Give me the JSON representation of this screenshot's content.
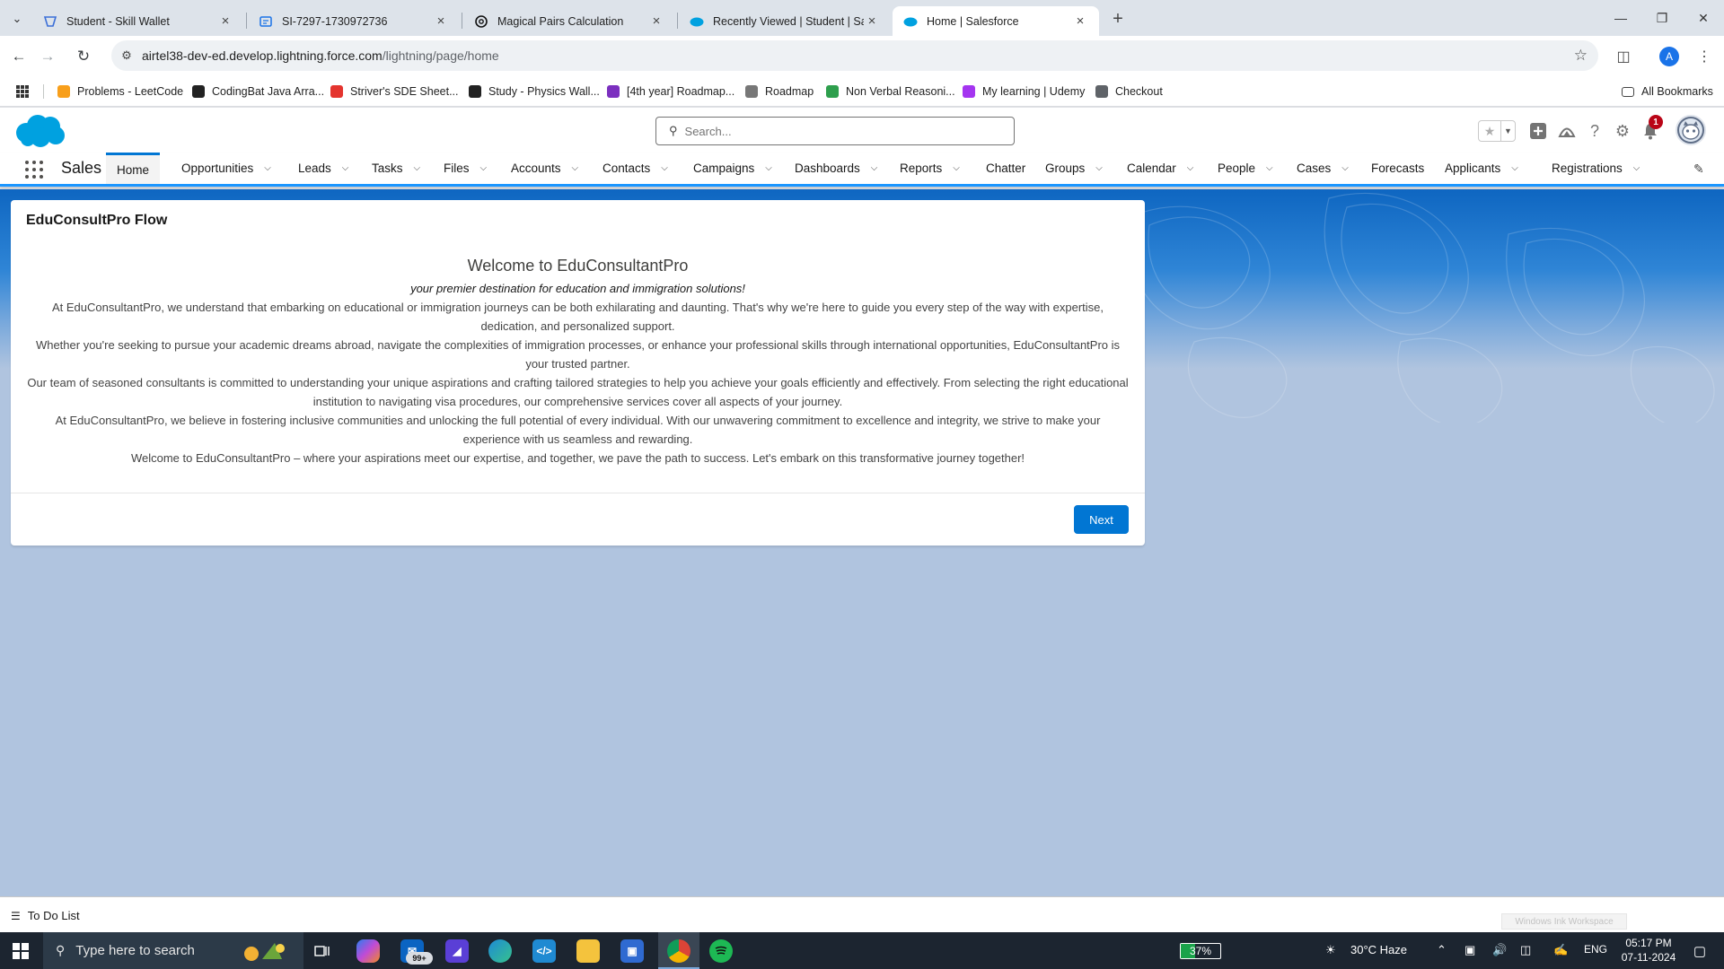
{
  "browser": {
    "tabs": [
      {
        "title": "Student - Skill Wallet",
        "icon": "skill-wallet-icon"
      },
      {
        "title": "SI-7297-1730972736",
        "icon": "document-icon"
      },
      {
        "title": "Magical Pairs Calculation",
        "icon": "chatgpt-icon"
      },
      {
        "title": "Recently Viewed | Student | Sal",
        "icon": "salesforce-cloud-icon"
      },
      {
        "title": "Home | Salesforce",
        "icon": "salesforce-cloud-icon"
      }
    ],
    "active_tab_index": 4,
    "url_host": "airtel38-dev-ed.develop.lightning.force.com",
    "url_path": "/lightning/page/home",
    "profile_initial": "A",
    "bookmarks": [
      {
        "label": "Problems - LeetCode",
        "icon": "leetcode-icon",
        "color": "#f89f1b"
      },
      {
        "label": "CodingBat Java Arra...",
        "icon": "codingbat-icon",
        "color": "#222222"
      },
      {
        "label": "Striver's SDE Sheet...",
        "icon": "tuf-icon",
        "color": "#e4342e"
      },
      {
        "label": "Study - Physics Wall...",
        "icon": "physics-wallah-icon",
        "color": "#222222"
      },
      {
        "label": "[4th year] Roadmap...",
        "icon": "roadmap-icon",
        "color": "#7b2fbf"
      },
      {
        "label": "Roadmap",
        "icon": "rocket-icon",
        "color": "#777777"
      },
      {
        "label": "Non Verbal Reasoni...",
        "icon": "leaf-icon",
        "color": "#2e9f4d"
      },
      {
        "label": "My learning | Udemy",
        "icon": "udemy-icon",
        "color": "#a435f0"
      },
      {
        "label": "Checkout",
        "icon": "checkout-icon",
        "color": "#5f6368"
      }
    ],
    "all_bookmarks_label": "All Bookmarks"
  },
  "sf": {
    "search_placeholder": "Search...",
    "notification_count": "1",
    "app_name": "Sales",
    "nav": [
      {
        "label": "Home",
        "dropdown": false,
        "active": true
      },
      {
        "label": "Opportunities",
        "dropdown": true
      },
      {
        "label": "Leads",
        "dropdown": true
      },
      {
        "label": "Tasks",
        "dropdown": true
      },
      {
        "label": "Files",
        "dropdown": true
      },
      {
        "label": "Accounts",
        "dropdown": true
      },
      {
        "label": "Contacts",
        "dropdown": true
      },
      {
        "label": "Campaigns",
        "dropdown": true
      },
      {
        "label": "Dashboards",
        "dropdown": true
      },
      {
        "label": "Reports",
        "dropdown": true
      },
      {
        "label": "Chatter",
        "dropdown": false
      },
      {
        "label": "Groups",
        "dropdown": true
      },
      {
        "label": "Calendar",
        "dropdown": true
      },
      {
        "label": "People",
        "dropdown": true
      },
      {
        "label": "Cases",
        "dropdown": true
      },
      {
        "label": "Forecasts",
        "dropdown": false
      },
      {
        "label": "Applicants",
        "dropdown": true
      },
      {
        "label": "Registrations",
        "dropdown": true
      }
    ]
  },
  "flow": {
    "title": "EduConsultPro Flow",
    "welcome": "Welcome to EduConsultantPro",
    "tagline": "your premier destination for education and immigration solutions!",
    "paragraphs": [
      "At EduConsultantPro, we understand that embarking on educational or immigration journeys can be both exhilarating and daunting. That's why we're here to guide you every step of the way with expertise, dedication, and personalized support.",
      "Whether you're seeking to pursue your academic dreams abroad, navigate the complexities of immigration processes, or enhance your professional skills through international opportunities, EduConsultantPro is your trusted partner.",
      "Our team of seasoned consultants is committed to understanding your unique aspirations and crafting tailored strategies to help you achieve your goals efficiently and effectively. From selecting the right educational institution to navigating visa procedures, our comprehensive services cover all aspects of your journey.",
      "At EduConsultantPro, we believe in fostering inclusive communities and unlocking the full potential of every individual. With our unwavering commitment to excellence and integrity, we strive to make your experience with us seamless and rewarding.",
      "Welcome to EduConsultantPro – where your aspirations meet our expertise, and together, we pave the path to success. Let's embark on this transformative journey together!"
    ],
    "next_label": "Next"
  },
  "utility": {
    "todo_label": "To Do List",
    "ink_hint": "Windows Ink Workspace"
  },
  "taskbar": {
    "search_placeholder": "Type here to search",
    "mail_badge": "99+",
    "battery_percent": 37,
    "battery_label": "37%",
    "weather": "30°C  Haze",
    "language": "ENG",
    "time": "05:17 PM",
    "date": "07-11-2024"
  },
  "colors": {
    "brand": "#0176d3",
    "banner": "#0e66c1",
    "page_bg": "#b0c4df",
    "badge": "#ba0517"
  }
}
